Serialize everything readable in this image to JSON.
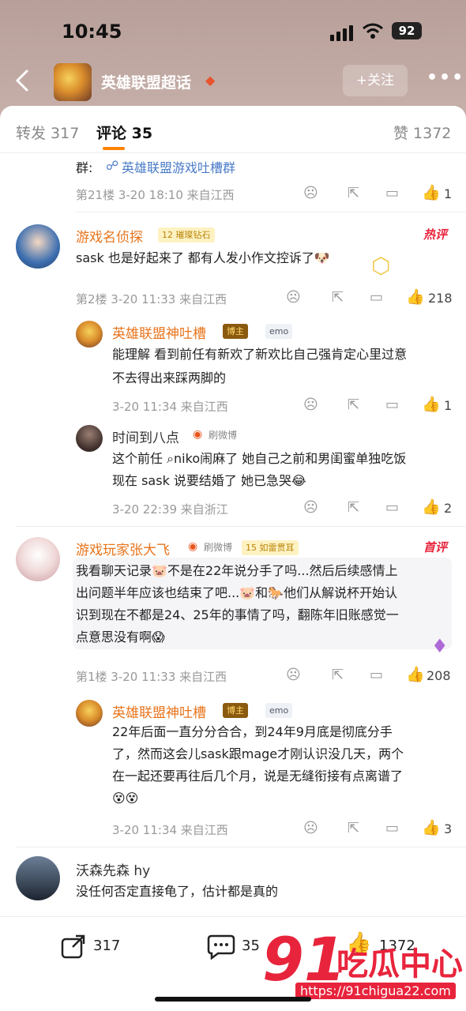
{
  "status": {
    "time": "10:45",
    "battery": "92"
  },
  "nav": {
    "title": "英雄联盟超话",
    "follow": "+关注"
  },
  "tabs": {
    "repost": "转发 317",
    "comment": "评论 35",
    "likes": "赞 1372"
  },
  "top_comment_tail": {
    "group_label": "群:",
    "group_name": "英雄联盟游戏吐槽群",
    "meta": "第21楼  3-20 18:10  来自江西",
    "likes": "1"
  },
  "comments": [
    {
      "name": "游戏名侦探",
      "badge": "璀璨钻石",
      "badge_level": "12",
      "tag": "热评",
      "text": "sask 也是好起来了 都有人发小作文控诉了🐶",
      "meta": "第2楼  3-20 11:33  来自江西",
      "likes": "218",
      "replies": [
        {
          "name": "英雄联盟神吐槽",
          "role": "博主",
          "mood": "emo",
          "text_lines": [
            "能理解 看到前任有新欢了新欢比自己强肯定心里过意",
            "不去得出来踩两脚的"
          ],
          "meta": "3-20 11:34  来自江西",
          "likes": "1"
        },
        {
          "name": "时间到八点",
          "client": "刷微博",
          "text_lines": [
            "这个前任 ⌕niko闹麻了 她自己之前和男闺蜜单独吃饭",
            "现在 sask 说要结婚了 她已急哭😂"
          ],
          "meta": "3-20 22:39  来自浙江",
          "likes": "2"
        }
      ]
    },
    {
      "name": "游戏玩家张大飞",
      "client": "刷微博",
      "badge": "如雷贯耳",
      "badge_level": "15",
      "tag": "首评",
      "text_lines": [
        "我看聊天记录🐷不是在22年说分手了吗...然后后续感情上",
        "出问题半年应该也结束了吧...🐷和🐎他们从解说杯开始认",
        "识到现在不都是24、25年的事情了吗，翻陈年旧账感觉一",
        "点意思没有啊😱"
      ],
      "meta": "第1楼  3-20 11:33  来自江西",
      "likes": "208",
      "replies": [
        {
          "name": "英雄联盟神吐槽",
          "role": "博主",
          "mood": "emo",
          "text_lines": [
            "22年后面一直分分合合，到24年9月底是彻底分手",
            "了，然而这会儿sask跟mage才刚认识没几天，两个",
            "在一起还要再往后几个月，说是无缝衔接有点离谱了",
            "😵😵"
          ],
          "meta": "3-20 11:34  来自江西",
          "likes": "3"
        }
      ]
    },
    {
      "name": "沃森先森 hy",
      "text": "没任何否定直接龟了，估计都是真的"
    }
  ],
  "bottom": {
    "repost": "317",
    "comment": "35",
    "like": "1372"
  },
  "watermark": {
    "big": "91",
    "cn": "吃瓜中心",
    "url": "https://91chigua22.com"
  },
  "colors": {
    "accent": "#ff8200",
    "name": "#e8741c",
    "watermark": "#e8243c"
  }
}
